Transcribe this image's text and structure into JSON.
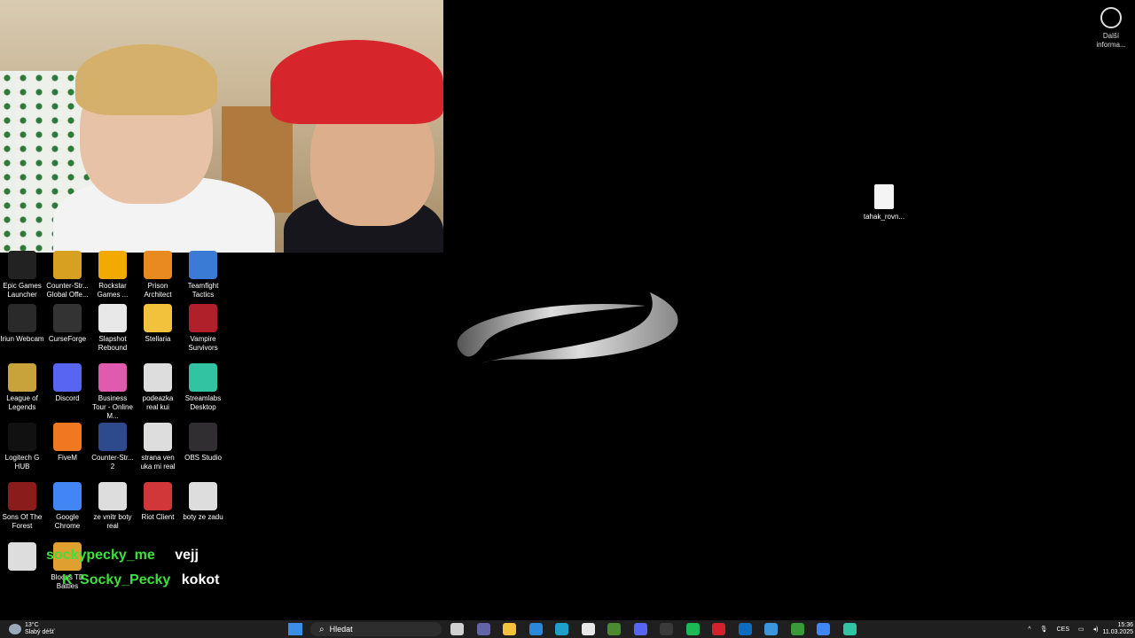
{
  "webcam": {
    "label": "webcam overlay"
  },
  "widget": {
    "label": "Další informa..."
  },
  "desktop_file": {
    "label": "tahak_rovn..."
  },
  "icons": [
    {
      "label": "Epic Games Launcher",
      "icon": "epic-games-icon",
      "color": "#222222"
    },
    {
      "label": "Counter-Str... Global Offe...",
      "icon": "csgo-icon",
      "color": "#d8a020"
    },
    {
      "label": "Rockstar Games ...",
      "icon": "rockstar-icon",
      "color": "#f2a900"
    },
    {
      "label": "Prison Architect",
      "icon": "prison-architect-icon",
      "color": "#e88a20"
    },
    {
      "label": "Teamfight Tactics",
      "icon": "tft-icon",
      "color": "#3a7bd5"
    },
    {
      "label": "Iriun Webcam",
      "icon": "iriun-icon",
      "color": "#2a2a2a"
    },
    {
      "label": "CurseForge",
      "icon": "curseforge-icon",
      "color": "#333333"
    },
    {
      "label": "Slapshot Rebound",
      "icon": "slapshot-icon",
      "color": "#e8e8e8"
    },
    {
      "label": "Stellaria",
      "icon": "folder-icon",
      "color": "#f2c23c"
    },
    {
      "label": "Vampire Survivors",
      "icon": "vampire-survivors-icon",
      "color": "#b0202a"
    },
    {
      "label": "League of Legends",
      "icon": "lol-icon",
      "color": "#c8a23a"
    },
    {
      "label": "Discord",
      "icon": "discord-icon",
      "color": "#5865f2"
    },
    {
      "label": "Business Tour - Online M...",
      "icon": "business-tour-icon",
      "color": "#e05ab0"
    },
    {
      "label": "podeazka real kui",
      "icon": "shoe-insole-icon",
      "color": "#dddddd"
    },
    {
      "label": "Streamlabs Desktop",
      "icon": "streamlabs-icon",
      "color": "#31c3a2"
    },
    {
      "label": "Logitech G HUB",
      "icon": "logitech-icon",
      "color": "#111111"
    },
    {
      "label": "FiveM",
      "icon": "fivem-icon",
      "color": "#f07820"
    },
    {
      "label": "Counter-Str... 2",
      "icon": "cs2-icon",
      "color": "#2d4a8c"
    },
    {
      "label": "strana ven uka mi real",
      "icon": "shoe-icon",
      "color": "#dddddd"
    },
    {
      "label": "OBS Studio",
      "icon": "obs-icon",
      "color": "#302e31"
    },
    {
      "label": "Sons Of The Forest",
      "icon": "sons-forest-icon",
      "color": "#8a1c1c"
    },
    {
      "label": "Google Chrome",
      "icon": "chrome-icon",
      "color": "#4285f4"
    },
    {
      "label": "ze vnitr boty real",
      "icon": "shoe-icon",
      "color": "#dddddd"
    },
    {
      "label": "Riot Client",
      "icon": "riot-icon",
      "color": "#d13639"
    },
    {
      "label": "boty ze zadu",
      "icon": "file-icon",
      "color": "#dddddd"
    },
    {
      "label": "",
      "icon": "file-icon",
      "color": "#dddddd"
    },
    {
      "label": "Bloons TD Battles",
      "icon": "bloons-icon",
      "color": "#e0a030"
    }
  ],
  "chat": [
    {
      "user": "sockypecky_me",
      "message": "vejj"
    },
    {
      "user": "Socky_Pecky",
      "message": "kokot"
    }
  ],
  "taskbar": {
    "weather_temp": "13°C",
    "weather_desc": "Slabý déšť",
    "search_placeholder": "Hledat",
    "notification_badge": "99+",
    "lang": "CES",
    "time": "15:36",
    "date": "11.03.2025",
    "apps": [
      {
        "icon": "task-view-icon",
        "color": "#d0d0d0"
      },
      {
        "icon": "teams-icon",
        "color": "#6264a7"
      },
      {
        "icon": "file-explorer-icon",
        "color": "#f2c23c"
      },
      {
        "icon": "mail-icon",
        "color": "#2b88d8"
      },
      {
        "icon": "edge-icon",
        "color": "#1fa0c8"
      },
      {
        "icon": "store-icon",
        "color": "#e8e8e8"
      },
      {
        "icon": "minecraft-icon",
        "color": "#4b8a2e"
      },
      {
        "icon": "discord-icon",
        "color": "#5865f2"
      },
      {
        "icon": "obs-icon",
        "color": "#3a3a3a"
      },
      {
        "icon": "spotify-icon",
        "color": "#1db954"
      },
      {
        "icon": "opera-icon",
        "color": "#d3212d"
      },
      {
        "icon": "outlook-icon",
        "color": "#0f6cbd"
      },
      {
        "icon": "azure-icon",
        "color": "#3a96dd"
      },
      {
        "icon": "xbox-icon",
        "color": "#3a9a3a"
      },
      {
        "icon": "chrome-icon",
        "color": "#4285f4"
      },
      {
        "icon": "streamlabs-icon",
        "color": "#31c3a2"
      }
    ]
  }
}
